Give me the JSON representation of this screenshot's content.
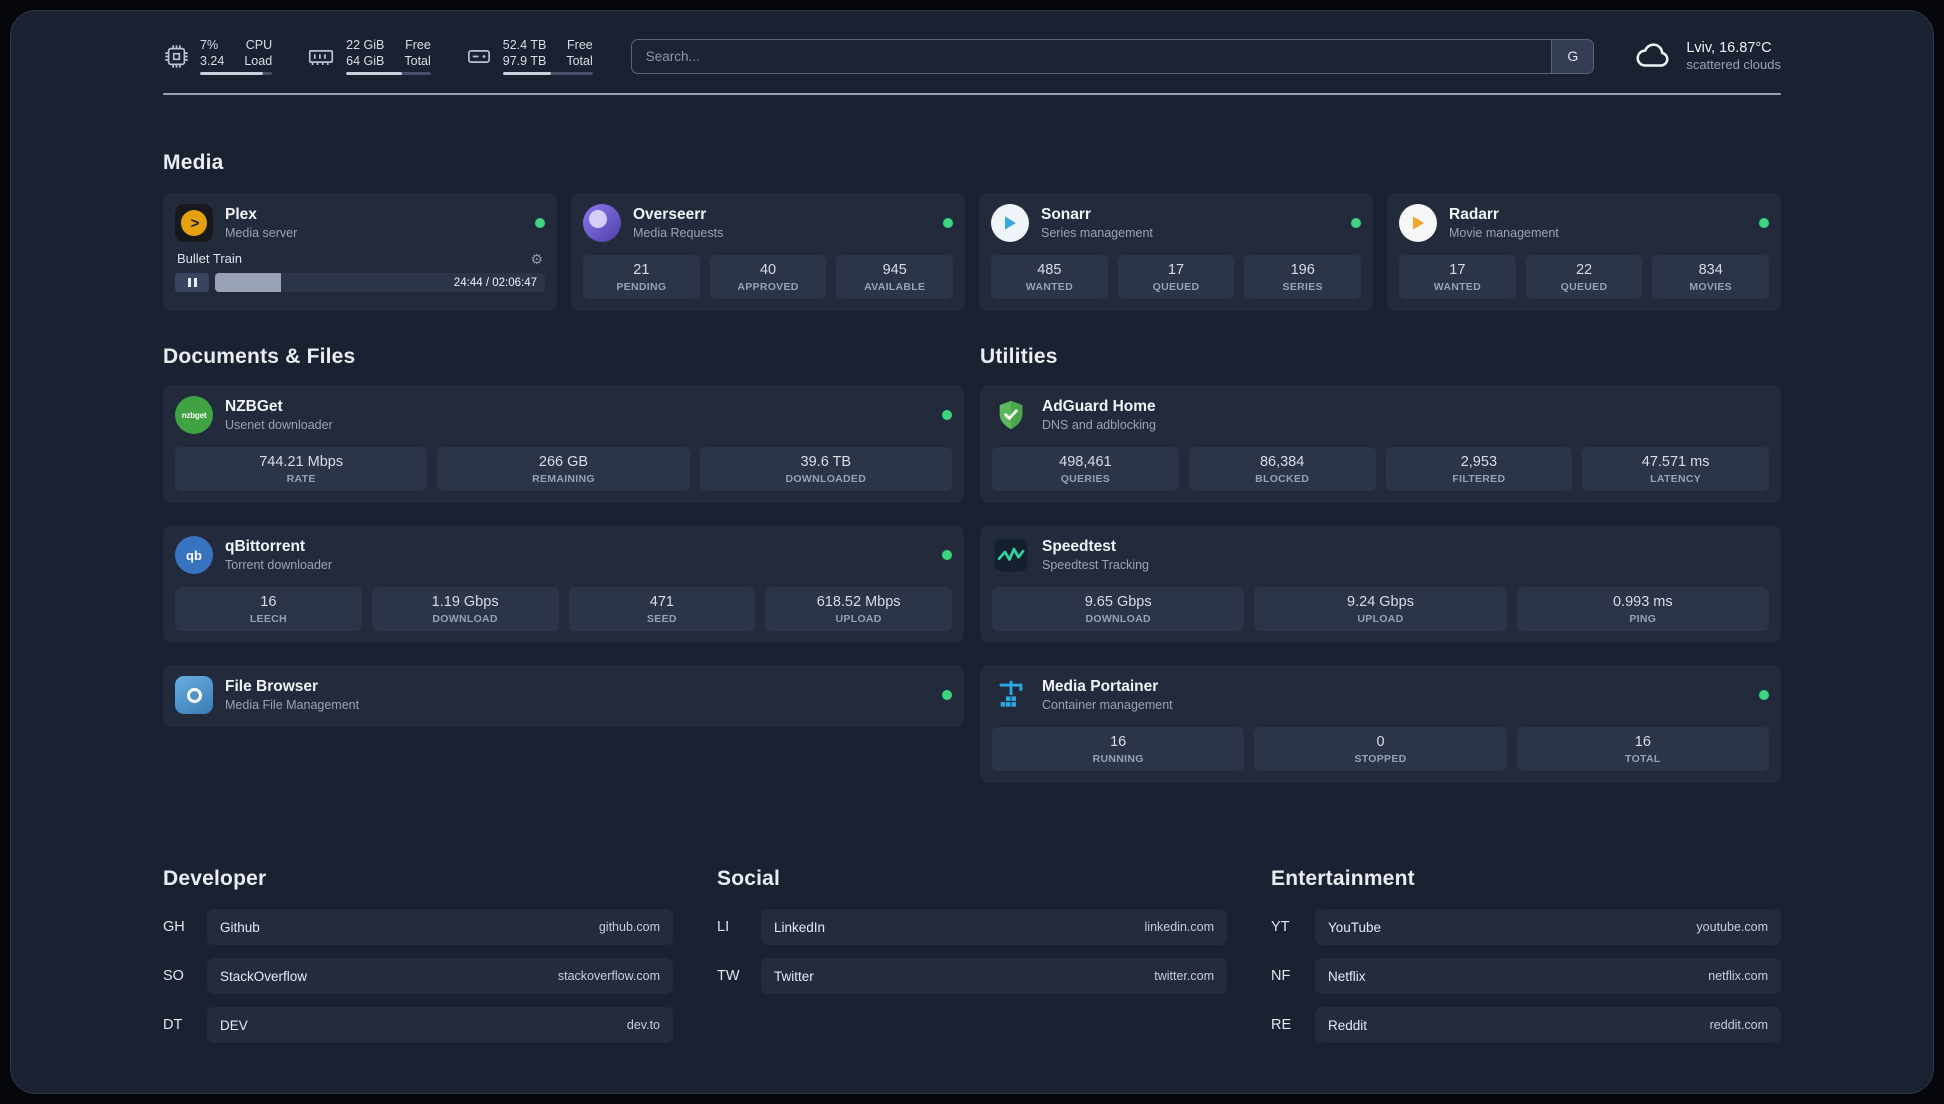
{
  "theme": {
    "background": "#1a2131",
    "card": "#222a3c",
    "stat_block": "#2c3448",
    "status_online": "#3ed37d",
    "plex_amber": "#e5a00d",
    "portainer_blue": "#29abe2",
    "adguard_green": "#5eb95e"
  },
  "topbar": {
    "widgets": [
      {
        "name": "cpu",
        "value_top": "7%",
        "value_bottom": "3.24",
        "label_top": "CPU",
        "label_bottom": "Load",
        "progress": 88
      },
      {
        "name": "memory",
        "value_top": "22 GiB",
        "value_bottom": "64 GiB",
        "label_top": "Free",
        "label_bottom": "Total",
        "progress": 66
      },
      {
        "name": "disk",
        "value_top": "52.4 TB",
        "value_bottom": "97.9 TB",
        "label_top": "Free",
        "label_bottom": "Total",
        "progress": 54
      }
    ],
    "search": {
      "placeholder": "Search...",
      "provider_label": "G"
    },
    "weather": {
      "location": "Lviv, 16.87°C",
      "condition": "scattered clouds"
    }
  },
  "sections": {
    "media": {
      "title": "Media",
      "cards": [
        {
          "name": "Plex",
          "desc": "Media server",
          "online": true,
          "player": {
            "title": "Bullet Train",
            "time": "24:44 / 02:06:47",
            "progress": 20
          }
        },
        {
          "name": "Overseerr",
          "desc": "Media Requests",
          "online": true,
          "stats": [
            {
              "value": "21",
              "label": "PENDING"
            },
            {
              "value": "40",
              "label": "APPROVED"
            },
            {
              "value": "945",
              "label": "AVAILABLE"
            }
          ]
        },
        {
          "name": "Sonarr",
          "desc": "Series management",
          "online": true,
          "stats": [
            {
              "value": "485",
              "label": "WANTED"
            },
            {
              "value": "17",
              "label": "QUEUED"
            },
            {
              "value": "196",
              "label": "SERIES"
            }
          ]
        },
        {
          "name": "Radarr",
          "desc": "Movie management",
          "online": true,
          "stats": [
            {
              "value": "17",
              "label": "WANTED"
            },
            {
              "value": "22",
              "label": "QUEUED"
            },
            {
              "value": "834",
              "label": "MOVIES"
            }
          ]
        }
      ]
    },
    "documents": {
      "title": "Documents & Files",
      "cards": [
        {
          "name": "NZBGet",
          "desc": "Usenet downloader",
          "online": true,
          "stats": [
            {
              "value": "744.21 Mbps",
              "label": "RATE"
            },
            {
              "value": "266 GB",
              "label": "REMAINING"
            },
            {
              "value": "39.6 TB",
              "label": "DOWNLOADED"
            }
          ]
        },
        {
          "name": "qBittorrent",
          "desc": "Torrent downloader",
          "online": true,
          "stats": [
            {
              "value": "16",
              "label": "LEECH"
            },
            {
              "value": "1.19 Gbps",
              "label": "DOWNLOAD"
            },
            {
              "value": "471",
              "label": "SEED"
            },
            {
              "value": "618.52 Mbps",
              "label": "UPLOAD"
            }
          ]
        },
        {
          "name": "File Browser",
          "desc": "Media File Management",
          "online": true,
          "stats": []
        }
      ]
    },
    "utilities": {
      "title": "Utilities",
      "cards": [
        {
          "name": "AdGuard Home",
          "desc": "DNS and adblocking",
          "stats": [
            {
              "value": "498,461",
              "label": "QUERIES"
            },
            {
              "value": "86,384",
              "label": "BLOCKED"
            },
            {
              "value": "2,953",
              "label": "FILTERED"
            },
            {
              "value": "47.571 ms",
              "label": "LATENCY"
            }
          ]
        },
        {
          "name": "Speedtest",
          "desc": "Speedtest Tracking",
          "stats": [
            {
              "value": "9.65 Gbps",
              "label": "DOWNLOAD"
            },
            {
              "value": "9.24 Gbps",
              "label": "UPLOAD"
            },
            {
              "value": "0.993 ms",
              "label": "PING"
            }
          ]
        },
        {
          "name": "Media Portainer",
          "desc": "Container management",
          "online": true,
          "stats": [
            {
              "value": "16",
              "label": "RUNNING"
            },
            {
              "value": "0",
              "label": "STOPPED"
            },
            {
              "value": "16",
              "label": "TOTAL"
            }
          ]
        }
      ]
    }
  },
  "bookmarks": [
    {
      "title": "Developer",
      "items": [
        {
          "abbr": "GH",
          "name": "Github",
          "url": "github.com"
        },
        {
          "abbr": "SO",
          "name": "StackOverflow",
          "url": "stackoverflow.com"
        },
        {
          "abbr": "DT",
          "name": "DEV",
          "url": "dev.to"
        }
      ]
    },
    {
      "title": "Social",
      "items": [
        {
          "abbr": "LI",
          "name": "LinkedIn",
          "url": "linkedin.com"
        },
        {
          "abbr": "TW",
          "name": "Twitter",
          "url": "twitter.com"
        }
      ]
    },
    {
      "title": "Entertainment",
      "items": [
        {
          "abbr": "YT",
          "name": "YouTube",
          "url": "youtube.com"
        },
        {
          "abbr": "NF",
          "name": "Netflix",
          "url": "netflix.com"
        },
        {
          "abbr": "RE",
          "name": "Reddit",
          "url": "reddit.com"
        }
      ]
    }
  ]
}
